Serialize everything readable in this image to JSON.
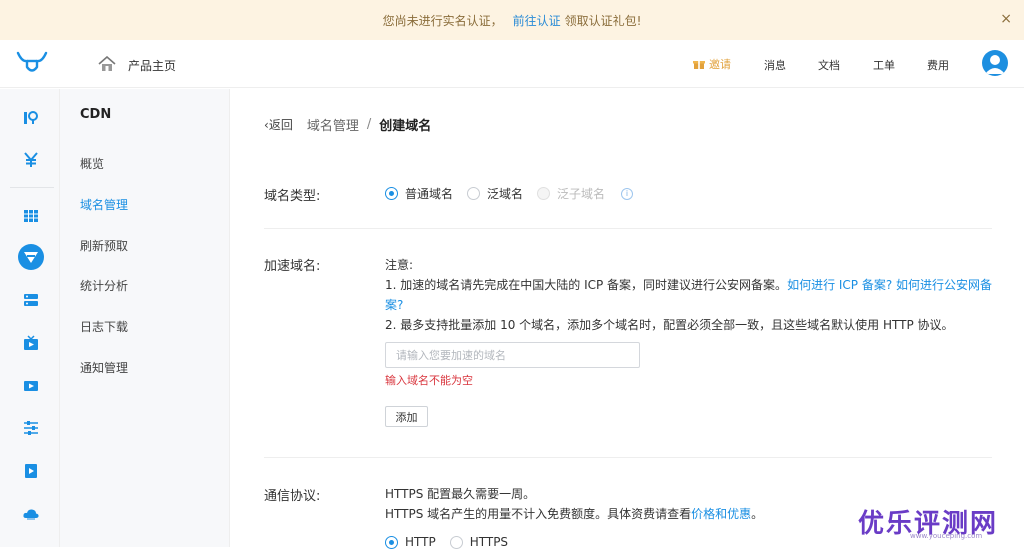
{
  "banner": {
    "message": "您尚未进行实名认证，",
    "link": "前往认证",
    "suffix": "领取认证礼包!",
    "close": "×"
  },
  "header": {
    "product_home": "产品主页",
    "invite": "邀请",
    "messages": "消息",
    "docs": "文档",
    "tickets": "工单",
    "billing": "费用",
    "accent_color": "#1a8fe3"
  },
  "sidebar": {
    "title": "CDN",
    "items": [
      {
        "label": "概览",
        "active": false
      },
      {
        "label": "域名管理",
        "active": true
      },
      {
        "label": "刷新预取",
        "active": false
      },
      {
        "label": "统计分析",
        "active": false
      },
      {
        "label": "日志下载",
        "active": false
      },
      {
        "label": "通知管理",
        "active": false
      }
    ]
  },
  "icon_rail": [
    "route-icon",
    "yen-icon",
    "grid-icon",
    "cdn-icon",
    "server-icon",
    "tv-icon",
    "video-icon",
    "sliders-icon",
    "play-icon",
    "cloud-icon"
  ],
  "breadcrumb": {
    "back": "返回",
    "parent": "域名管理",
    "separator": "/",
    "current": "创建域名"
  },
  "domain_type": {
    "label": "域名类型:",
    "options": [
      {
        "label": "普通域名",
        "selected": true,
        "disabled": false
      },
      {
        "label": "泛域名",
        "selected": false,
        "disabled": false
      },
      {
        "label": "泛子域名",
        "selected": false,
        "disabled": true
      }
    ]
  },
  "accel_domain": {
    "label": "加速域名:",
    "note_title": "注意:",
    "note1_text": "1. 加速的域名请先完成在中国大陆的 ICP 备案，同时建议进行公安网备案。",
    "note1_link1": "如何进行 ICP 备案?",
    "note1_link2_a": "如何进行公安网备",
    "note1_link2_b": "案?",
    "note2": "2. 最多支持批量添加 10 个域名，添加多个域名时，配置必须全部一致，且这些域名默认使用 HTTP 协议。",
    "input_placeholder": "请输入您要加速的域名",
    "input_value": "",
    "error": "输入域名不能为空",
    "add_button": "添加"
  },
  "protocol": {
    "label": "通信协议:",
    "line1": "HTTPS 配置最久需要一周。",
    "line2_text": "HTTPS 域名产生的用量不计入免费额度。具体资费请查看",
    "line2_link": "价格和优惠",
    "line2_end": "。",
    "options": [
      {
        "label": "HTTP",
        "selected": true
      },
      {
        "label": "HTTPS",
        "selected": false
      }
    ]
  },
  "watermark": {
    "text": "优乐评测网",
    "sub": "www.youceping.com"
  }
}
